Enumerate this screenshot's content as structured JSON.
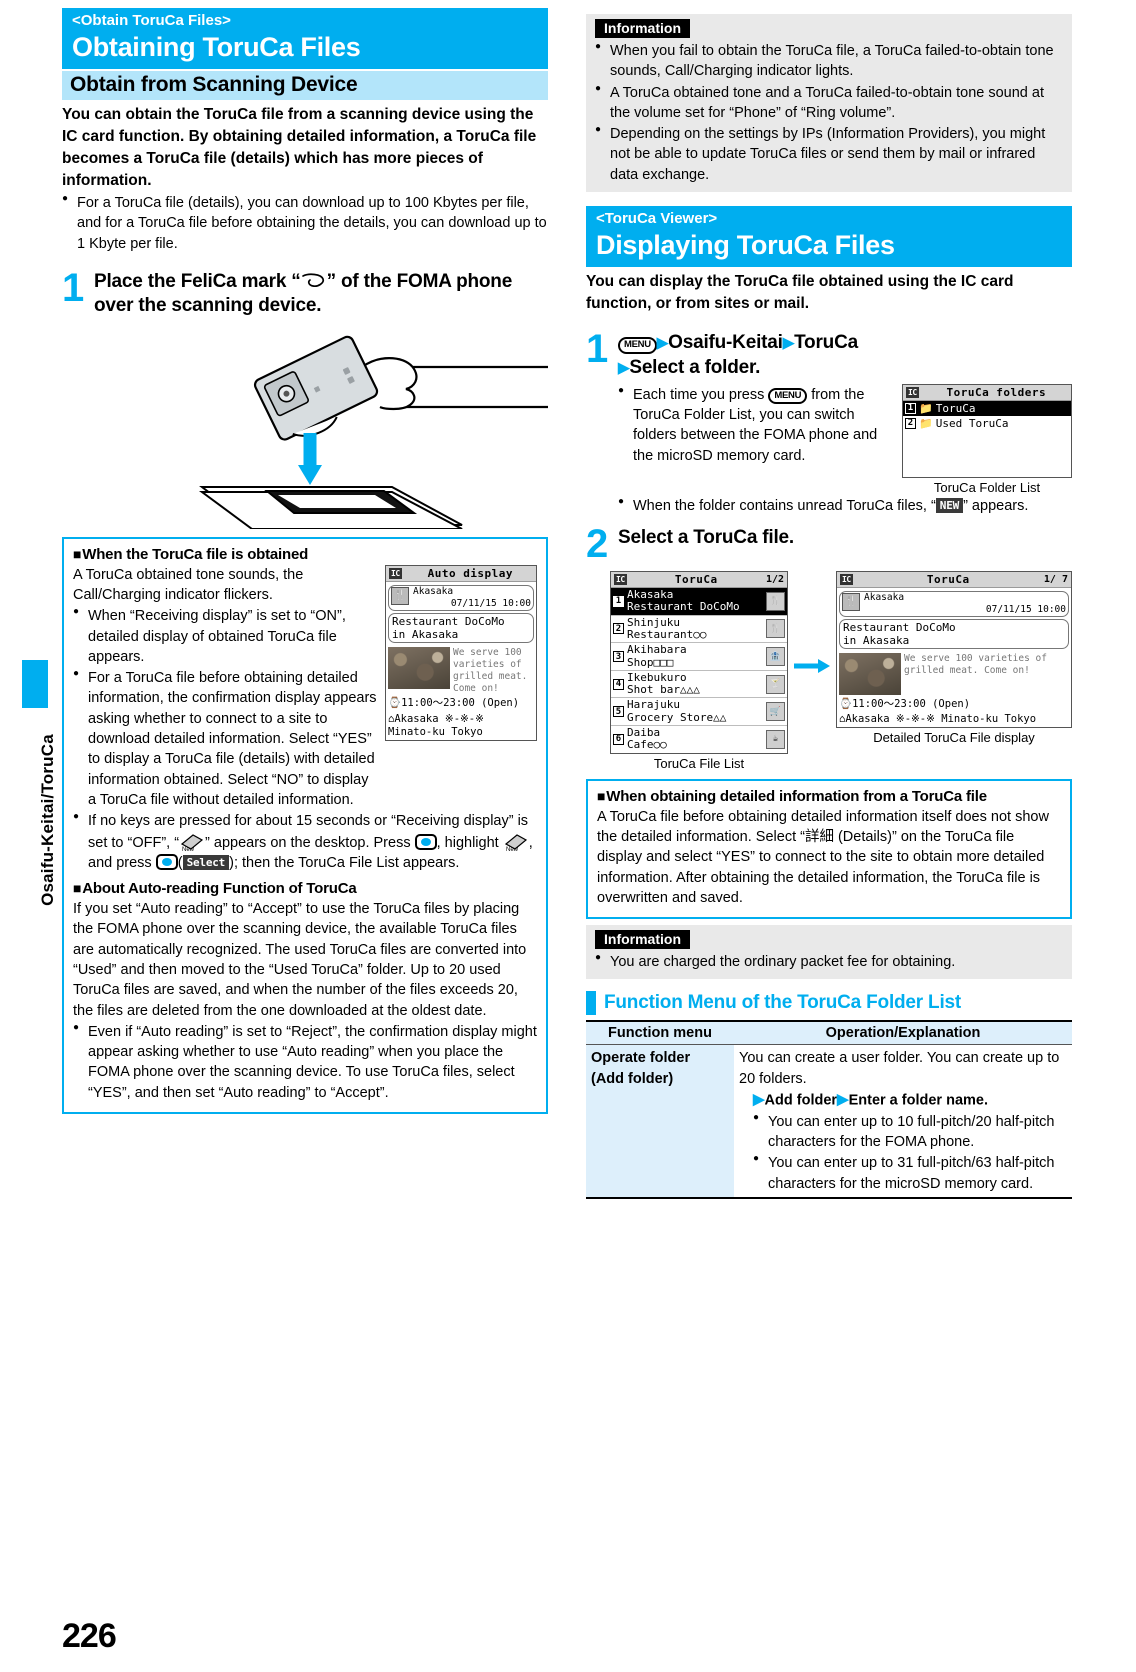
{
  "page": {
    "number": "226",
    "side_tab": "Osaifu-Keitai/ToruCa"
  },
  "left": {
    "section": {
      "kicker": "<Obtain ToruCa Files>",
      "title": "Obtaining ToruCa Files",
      "subhead": "Obtain from Scanning Device",
      "lead": "You can obtain the ToruCa file from a scanning device using the IC card function. By obtaining detailed information, a ToruCa file becomes a ToruCa file (details) which has more pieces of information.",
      "bullet1": "For a ToruCa file (details), you can download up to 100 Kbytes per file, and for a ToruCa file before obtaining the details, you can download up to 1 Kbyte per file."
    },
    "step1": {
      "num": "1",
      "title_a": "Place the FeliCa mark “",
      "title_b": "” of the FOMA phone over the scanning device."
    },
    "note_obtained": {
      "title": "When the ToruCa file is obtained",
      "p1": "A ToruCa obtained tone sounds, the Call/Charging indicator flickers.",
      "b1": "When “Receiving display” is set to “ON”, detailed display of obtained ToruCa file appears.",
      "b2": "For a ToruCa file before obtaining detailed information, the confirmation display appears asking whether to connect to a site to download detailed information. Select “YES” to display a ToruCa file (details) with detailed information obtained. Select “NO” to display a ToruCa file without detailed information.",
      "b3_a": "If no keys are pressed for about 15 seconds or “Receiving display” is set to “OFF”, “",
      "b3_b": "” appears on the desktop. Press ",
      "b3_c": ", highlight ",
      "b3_d": ", and press ",
      "b3_e": "(",
      "b3_f": "); then the ToruCa File List appears.",
      "select_key": "Select"
    },
    "note_autoread": {
      "title": "About Auto-reading Function of ToruCa",
      "p1": "If you set “Auto reading” to “Accept” to use the ToruCa files by placing the FOMA phone over the scanning device, the available ToruCa files are automatically recognized. The used ToruCa files are converted into “Used” and then moved to the “Used ToruCa” folder. Up to 20 used ToruCa files are saved, and when the number of the files exceeds 20, the files are deleted from the one downloaded at the oldest date.",
      "b1": "Even if “Auto reading” is set to “Reject”, the confirmation display might appear asking whether to use “Auto reading” when you place the FOMA phone over the scanning device. To use ToruCa files, select “YES”, and then set “Auto reading” to “Accept”."
    },
    "auto_display_shot": {
      "bar_title": "Auto display",
      "badge": "IC",
      "name": "Akasaka",
      "datetime": "07/11/15 10:00",
      "title": "Restaurant DoCoMo\nin Akasaka",
      "desc": "We serve 100 varieties of grilled meat. Come on!",
      "hours": "⌚11:00～23:00 (Open)",
      "address": "⌂Akasaka ※-※-※ Minato-ku Tokyo"
    }
  },
  "right": {
    "info1": {
      "tag": "Information",
      "b1": "When you fail to obtain the ToruCa file, a ToruCa failed-to-obtain tone sounds, Call/Charging indicator lights.",
      "b2": "A ToruCa obtained tone and a ToruCa failed-to-obtain tone sound at the volume set for “Phone” of “Ring volume”.",
      "b3": "Depending on the settings by IPs (Information Providers), you might not be able to update ToruCa files or send them by mail or infrared data exchange."
    },
    "section": {
      "kicker": "<ToruCa Viewer>",
      "title": "Displaying ToruCa Files",
      "lead": "You can display the ToruCa file obtained using the IC card function, or from sites or mail."
    },
    "step1": {
      "num": "1",
      "key": "MENU",
      "path_a": "Osaifu-Keitai",
      "path_b": "ToruCa",
      "path_c": "Select a folder.",
      "b1_a": "Each time you press ",
      "b1_b": " from the ToruCa Folder List, you can switch folders between the FOMA phone and the microSD memory card.",
      "b2_a": "When the folder contains unread ToruCa files, “",
      "b2_b": "” appears.",
      "new_badge": "NEW"
    },
    "folder_shot": {
      "badge": "IC",
      "bar_title": "ToruCa folders",
      "rows": [
        {
          "num": "1",
          "label": "ToruCa",
          "selected": true
        },
        {
          "num": "2",
          "label": "Used ToruCa",
          "selected": false
        }
      ],
      "caption": "ToruCa Folder List"
    },
    "step2": {
      "num": "2",
      "title": "Select a ToruCa file."
    },
    "file_list_shot": {
      "badge": "IC",
      "bar_title": "ToruCa",
      "page": "1/2",
      "rows": [
        {
          "num": "1",
          "line1": "Akasaka",
          "line2": "Restaurant DoCoMo",
          "icon": "restaurant-icon",
          "selected": true
        },
        {
          "num": "2",
          "line1": "Shinjuku",
          "line2": "Restaurant○○",
          "icon": "restaurant-icon",
          "selected": false
        },
        {
          "num": "3",
          "line1": "Akihabara",
          "line2": "Shop□□□",
          "icon": "shop-icon",
          "selected": false
        },
        {
          "num": "4",
          "line1": "Ikebukuro",
          "line2": "Shot bar△△△",
          "icon": "bar-icon",
          "selected": false
        },
        {
          "num": "5",
          "line1": "Harajuku",
          "line2": "Grocery Store△△",
          "icon": "grocery-icon",
          "selected": false
        },
        {
          "num": "6",
          "line1": "Daiba",
          "line2": "Cafe○○",
          "icon": "cafe-icon",
          "selected": false
        }
      ],
      "caption": "ToruCa File List"
    },
    "detail_shot": {
      "badge": "IC",
      "bar_title": "ToruCa",
      "page": "1/ 7",
      "name": "Akasaka",
      "datetime": "07/11/15 10:00",
      "title": "Restaurant DoCoMo\nin Akasaka",
      "desc": "We serve 100 varieties of grilled meat. Come on!",
      "hours": "⌚11:00～23:00 (Open)",
      "address": "⌂Akasaka ※-※-※ Minato-ku Tokyo",
      "caption": "Detailed ToruCa File display"
    },
    "note_detail": {
      "title": "When obtaining detailed information from a ToruCa file",
      "p1": "A ToruCa file before obtaining detailed information itself does not show the detailed information. Select “詳細 (Details)” on the ToruCa file display and select “YES” to connect to the site to obtain more detailed information. After obtaining the detailed information, the ToruCa file is overwritten and saved."
    },
    "info2": {
      "tag": "Information",
      "b1": "You are charged the ordinary packet fee for obtaining."
    },
    "fn_menu": {
      "heading": "Function Menu of the ToruCa Folder List",
      "col1": "Function menu",
      "col2": "Operation/Explanation",
      "rows": [
        {
          "name_line1": "Operate folder",
          "name_line2": "(Add folder)",
          "p1": "You can create a user folder. You can create up to 20 folders.",
          "op_a": "Add folder",
          "op_b": "Enter a folder name.",
          "b1": "You can enter up to 10 full-pitch/20 half-pitch characters for the FOMA phone.",
          "b2": "You can enter up to 31 full-pitch/63 half-pitch characters for the microSD memory card."
        }
      ]
    }
  },
  "colors": {
    "accent": "#00aeef",
    "subhead_bg": "#b3e5fa",
    "info_bg": "#e9e9e9",
    "table_cell_bg": "#ddeffb"
  }
}
